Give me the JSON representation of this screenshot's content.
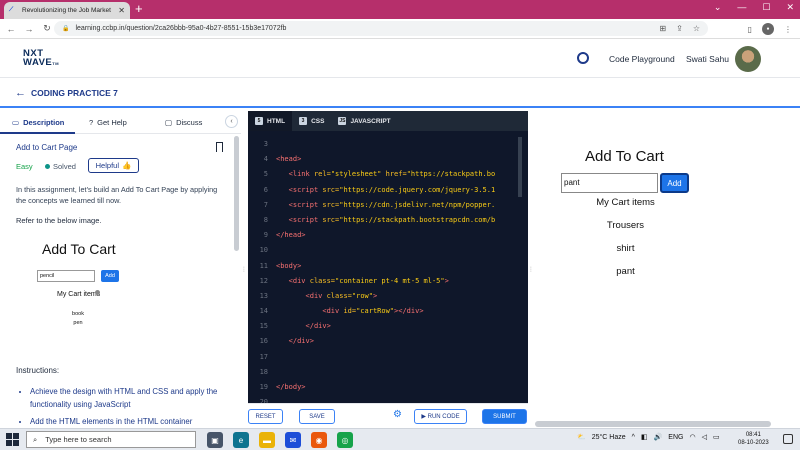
{
  "browser": {
    "tab_title": "Revolutionizing the Job Market",
    "url": "learning.ccbp.in/question/2ca26bbb-95a0-4b27-8551-15b3e17072fb",
    "new_tab": "+",
    "minimize": "—",
    "maximize": "☐",
    "close": "✕"
  },
  "header": {
    "logo_line1": "NXT",
    "logo_line2": "WAVE",
    "logo_tm": "TM",
    "code_playground": "Code Playground",
    "user_name": "Swati Sahu"
  },
  "subheader": {
    "title": "CODING PRACTICE 7"
  },
  "left_tabs": {
    "description": "Description",
    "get_help": "Get Help",
    "discuss": "Discuss"
  },
  "problem": {
    "title": "Add to Cart Page",
    "difficulty": "Easy",
    "status": "Solved",
    "helpful": "Helpful",
    "description": "In this assignment, let's build an Add To Cart Page by applying the concepts we learned till now.",
    "refer": "Refer to the below image.",
    "instructions_label": "Instructions:",
    "bullets": [
      "Achieve the design with HTML and CSS and apply the functionality using JavaScript",
      "Add the HTML elements in the HTML container element"
    ]
  },
  "reference_image": {
    "title": "Add To Cart",
    "input_value": "pencil",
    "button": "Add",
    "items_heading": "My Cart items",
    "items": [
      "book",
      "pen"
    ]
  },
  "editor": {
    "tabs": [
      "HTML",
      "CSS",
      "JAVASCRIPT"
    ],
    "line_numbers": [
      "3",
      "4",
      "5",
      "6",
      "7",
      "8",
      "9",
      "10",
      "11",
      "12",
      "13",
      "14",
      "15",
      "16",
      "17",
      "18",
      "19",
      "20"
    ],
    "code": {
      "l4_tag": "<head>",
      "l5_a": "<link ",
      "l5_b": "rel=",
      "l5_c": "\"stylesheet\" ",
      "l5_d": "href=",
      "l5_e": "\"https://stackpath.bo",
      "l6_a": "<script ",
      "l6_b": "src=",
      "l6_c": "\"https://code.jquery.com/jquery-3.5.1",
      "l7_c": "\"https://cdn.jsdelivr.net/npm/popper.",
      "l8_c": "\"https://stackpath.bootstrapcdn.com/b",
      "l9_tag": "</head>",
      "l11_tag": "<body>",
      "l12_a": "<div ",
      "l12_b": "class=",
      "l12_c": "\"container pt-4 mt-5 ml-5\"",
      "l12_d": ">",
      "l13_a": "<div ",
      "l13_b": "class=",
      "l13_c": "\"row\"",
      "l13_d": ">",
      "l14_a": "<div ",
      "l14_b": "id=",
      "l14_c": "\"cartRow\"",
      "l14_d": "></div>",
      "l15_tag": "</div>",
      "l16_tag": "</div>",
      "l19_tag": "</body>"
    }
  },
  "footer": {
    "reset": "RESET",
    "save": "SAVE",
    "run_code": "RUN CODE",
    "submit": "SUBMIT"
  },
  "preview": {
    "title": "Add To Cart",
    "input_value": "pant",
    "button": "Add",
    "items_heading": "My Cart items",
    "items": [
      "Trousers",
      "shirt",
      "pant"
    ]
  },
  "taskbar": {
    "search_placeholder": "Type here to search",
    "temperature": "25°C  Haze",
    "language": "ENG",
    "time": "08:41",
    "date": "08-10-2023"
  },
  "colors": {
    "accent": "#1d74e8",
    "brand_dark": "#1e3a8a",
    "tab_bar": "#b62f6b",
    "editor_bg": "#0f172a"
  }
}
